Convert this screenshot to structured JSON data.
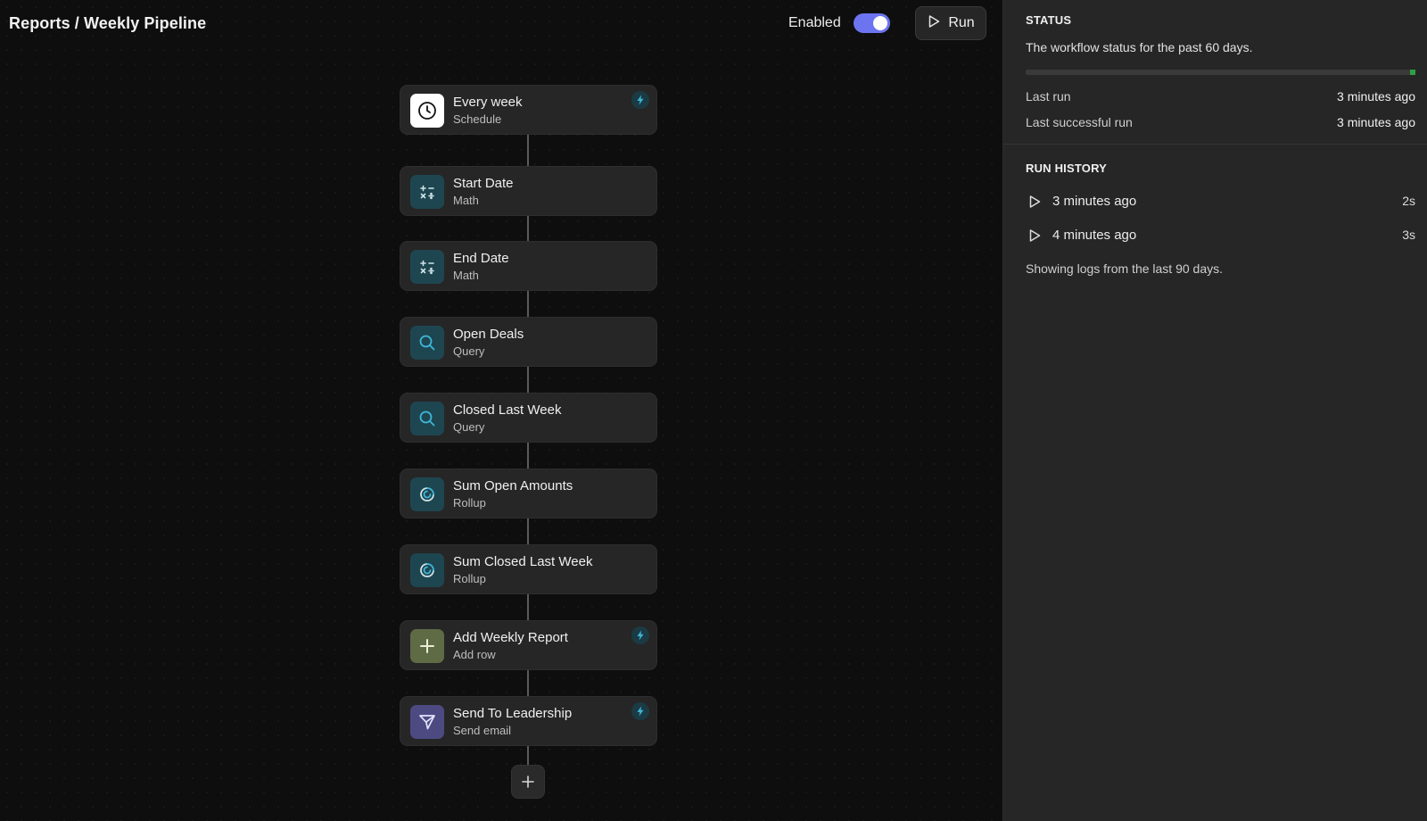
{
  "header": {
    "breadcrumb": "Reports / Weekly Pipeline",
    "enabled_label": "Enabled",
    "enabled": true,
    "run_label": "Run"
  },
  "colors": {
    "accent": "#6d74f0",
    "status_ok": "#2ea043",
    "math_icon_bg": "#1e4650",
    "query_icon_bg": "#1e4650",
    "rollup_icon_bg": "#1e4650",
    "add_row_icon_bg": "#5f6b45",
    "send_email_icon_bg": "#4d4a82"
  },
  "flow": {
    "steps": [
      {
        "title": "Every week",
        "subtitle": "Schedule",
        "icon": "clock-icon",
        "trigger": true
      },
      {
        "title": "Start Date",
        "subtitle": "Math",
        "icon": "math-icon",
        "trigger": false
      },
      {
        "title": "End Date",
        "subtitle": "Math",
        "icon": "math-icon",
        "trigger": false
      },
      {
        "title": "Open Deals",
        "subtitle": "Query",
        "icon": "search-icon",
        "trigger": false
      },
      {
        "title": "Closed Last Week",
        "subtitle": "Query",
        "icon": "search-icon",
        "trigger": false
      },
      {
        "title": "Sum Open Amounts",
        "subtitle": "Rollup",
        "icon": "rollup-icon",
        "trigger": false
      },
      {
        "title": "Sum Closed Last Week",
        "subtitle": "Rollup",
        "icon": "rollup-icon",
        "trigger": false
      },
      {
        "title": "Add Weekly Report",
        "subtitle": "Add row",
        "icon": "plus-icon",
        "trigger": true
      },
      {
        "title": "Send To Leadership",
        "subtitle": "Send email",
        "icon": "send-icon",
        "trigger": true
      }
    ],
    "add_step_icon": "plus-icon"
  },
  "status": {
    "heading": "STATUS",
    "description": "The workflow status for the past 60 days.",
    "last_run_label": "Last run",
    "last_run_value": "3 minutes ago",
    "last_success_label": "Last successful run",
    "last_success_value": "3 minutes ago"
  },
  "history": {
    "heading": "RUN HISTORY",
    "runs": [
      {
        "time": "3 minutes ago",
        "duration": "2s"
      },
      {
        "time": "4 minutes ago",
        "duration": "3s"
      }
    ],
    "note": "Showing logs from the last 90 days."
  }
}
